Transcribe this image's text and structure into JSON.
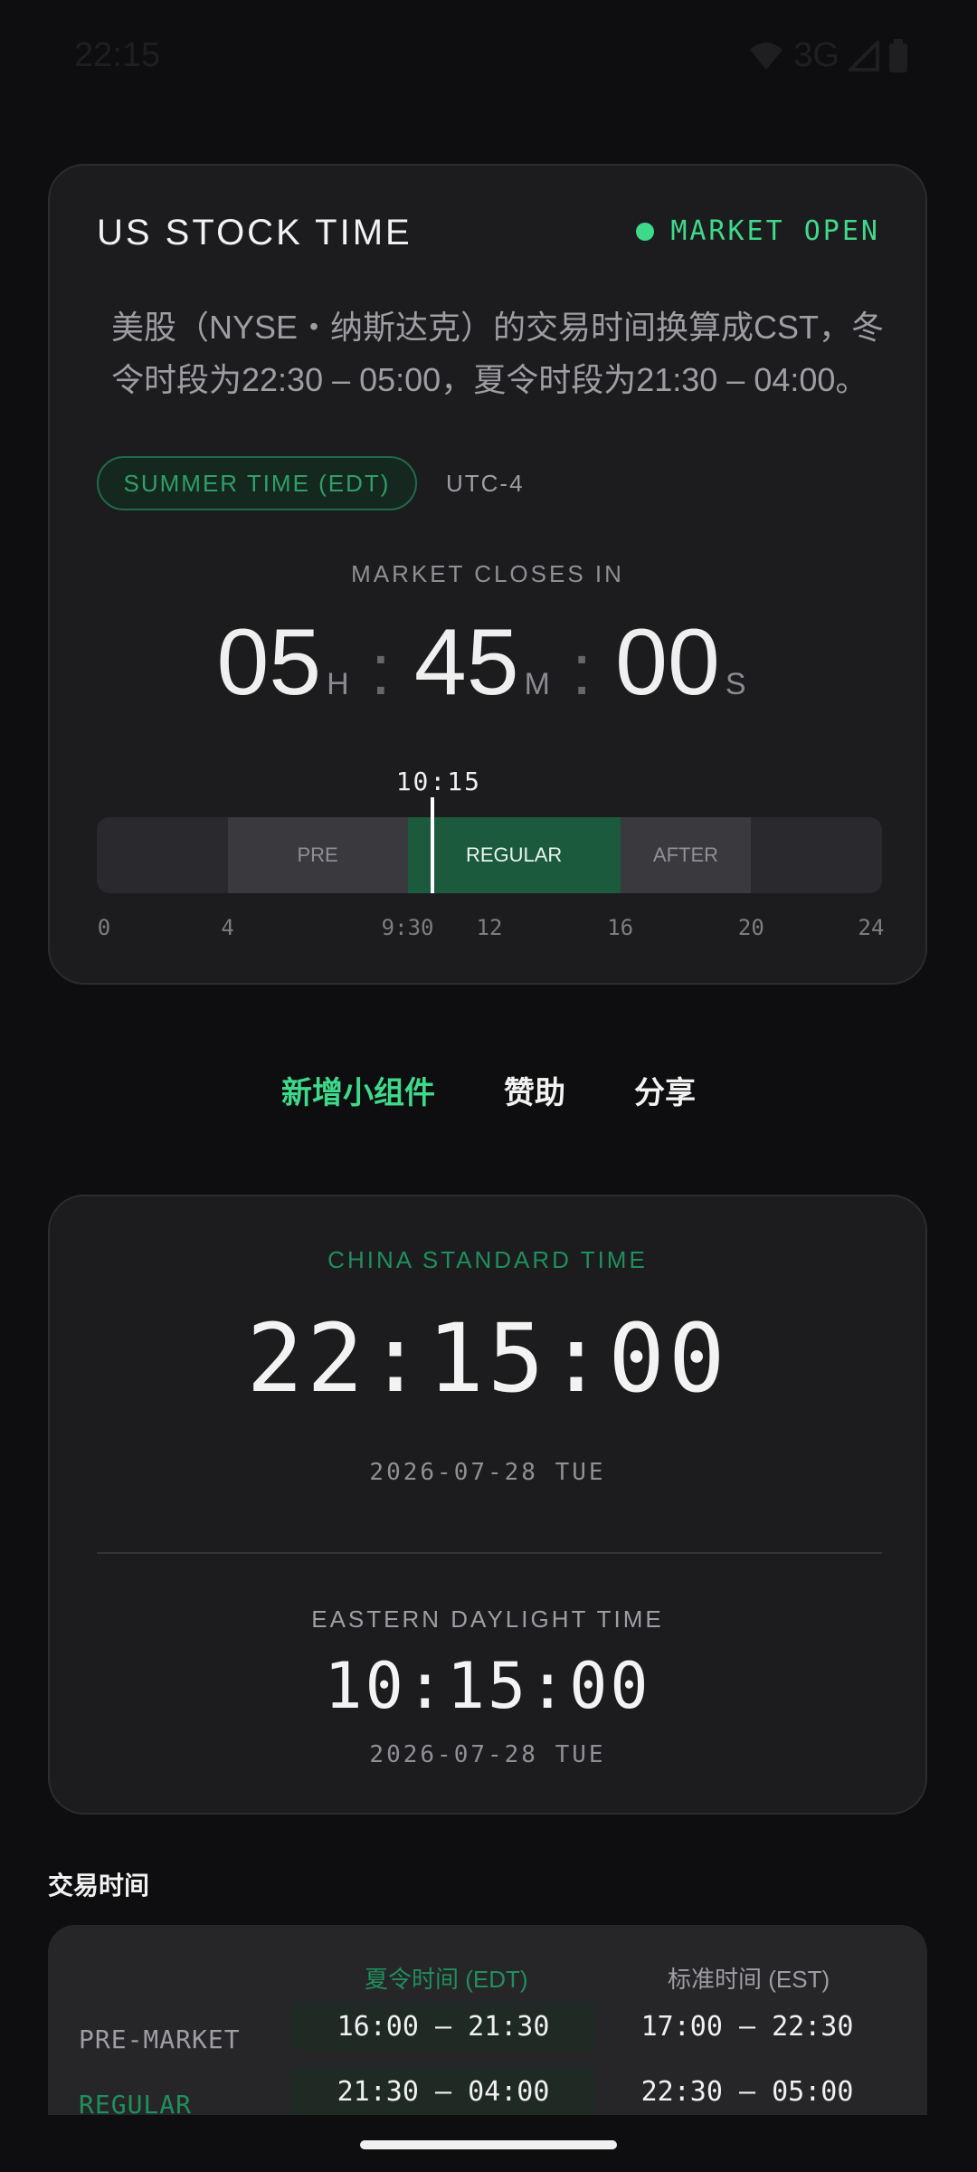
{
  "status_bar": {
    "time": "22:15",
    "network": "3G"
  },
  "header": {
    "title": "US STOCK TIME",
    "market_status": "MARKET OPEN",
    "description": "美股（NYSE・纳斯达克）的交易时间换算成CST，冬令时段为22:30 – 05:00，夏令时段为21:30 – 04:00。",
    "dst_badge": "SUMMER TIME (EDT)",
    "utc_offset": "UTC-4"
  },
  "countdown": {
    "label": "MARKET CLOSES IN",
    "hours": "05",
    "hours_unit": "H",
    "minutes": "45",
    "minutes_unit": "M",
    "seconds": "00",
    "seconds_unit": "S"
  },
  "timeline": {
    "now_label": "10:15",
    "now_hour": 10.25,
    "segments": [
      {
        "label": "PRE",
        "start": 4,
        "end": 9.5
      },
      {
        "label": "REGULAR",
        "start": 9.5,
        "end": 16
      },
      {
        "label": "AFTER",
        "start": 16,
        "end": 20
      }
    ],
    "ticks": [
      {
        "label": "0",
        "hour": 0
      },
      {
        "label": "4",
        "hour": 4
      },
      {
        "label": "9:30",
        "hour": 9.5
      },
      {
        "label": "12",
        "hour": 12
      },
      {
        "label": "16",
        "hour": 16
      },
      {
        "label": "20",
        "hour": 20
      },
      {
        "label": "24",
        "hour": 24
      }
    ]
  },
  "actions": {
    "add_widget": "新增小组件",
    "sponsor": "赞助",
    "share": "分享"
  },
  "clocks": {
    "china_label": "CHINA STANDARD TIME",
    "china_time": "22:15:00",
    "china_date": "2026-07-28 TUE",
    "eastern_label": "EASTERN DAYLIGHT TIME",
    "eastern_time": "10:15:00",
    "eastern_date": "2026-07-28 TUE"
  },
  "trading_hours": {
    "title": "交易时间",
    "col_summer": "夏令时间 (EDT)",
    "col_winter": "标准时间 (EST)",
    "rows": [
      {
        "label": "PRE-MARKET",
        "summer": "16:00 – 21:30",
        "winter": "17:00 – 22:30"
      },
      {
        "label": "REGULAR",
        "summer": "21:30 – 04:00",
        "winter": "22:30 – 05:00"
      }
    ]
  },
  "colors": {
    "accent": "#3fd98a",
    "regular_bar": "#1b5a3c",
    "card_bg": "#1c1c1f",
    "page_bg": "#0e0e10"
  }
}
